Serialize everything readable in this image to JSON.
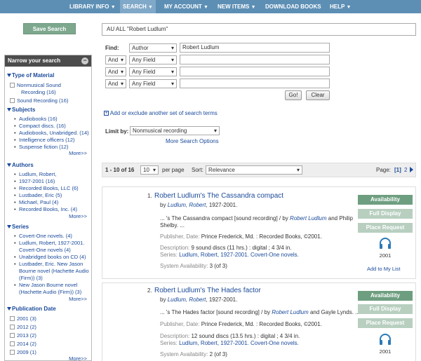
{
  "nav": {
    "items": [
      {
        "label": "LIBRARY INFO"
      },
      {
        "label": "SEARCH"
      },
      {
        "label": "MY ACCOUNT"
      },
      {
        "label": "NEW ITEMS"
      },
      {
        "label": "DOWNLOAD BOOKS"
      },
      {
        "label": "HELP"
      }
    ]
  },
  "sidebar": {
    "save_search": "Save Search",
    "narrow_title": "Narrow your search",
    "type_title": "Type of Material",
    "types": [
      "Nonmusical Sound",
      "Recording (16)",
      "Sound Recording (16)"
    ],
    "subjects_title": "Subjects",
    "subjects": [
      "Audiobooks (16)",
      "Compact discs. (16)",
      "Audiobooks, Unabridged. (14)",
      "Intelligence officers (12)",
      "Suspense fiction (12)"
    ],
    "more": "More>>",
    "authors_title": "Authors",
    "authors": [
      "Ludlum, Robert,",
      "1927-2001 (16)",
      "Recorded Books, LLC (6)",
      "Lustbader, Eric (5)",
      "Michael, Paul (4)",
      "Recorded Books, Inc. (4)"
    ],
    "series_title": "Series",
    "series": [
      "Covert-One novels. (4)",
      "Ludlum, Robert, 1927-2001.",
      "Covert-One novels (4)",
      "Unabridged books on CD (4)",
      "Lustbader, Eric. New Jason",
      "Bourne novel (Hachette Audio",
      "(Firm)) (3)",
      "New Jason Bourne novel",
      "(Hachette Audio (Firm)) (3)"
    ],
    "pubdate_title": "Publication Date",
    "pubdates": [
      "2001 (3)",
      "2012 (2)",
      "2013 (2)",
      "2014 (2)",
      "2009 (1)"
    ]
  },
  "search": {
    "query_summary": "AU ALL \"Robert Ludlum\"",
    "find_label": "Find:",
    "rows": [
      {
        "op": "",
        "field": "Author",
        "value": "Robert Ludlum"
      },
      {
        "op": "And",
        "field": "Any Field",
        "value": ""
      },
      {
        "op": "And",
        "field": "Any Field",
        "value": ""
      },
      {
        "op": "And",
        "field": "Any Field",
        "value": ""
      }
    ],
    "go": "Go!",
    "clear": "Clear",
    "add_set": "Add or exclude another set of search terms",
    "limit_label": "Limit by:",
    "limit_value": "Nonmusical recording",
    "more_options": "More Search Options"
  },
  "results": {
    "range": "1 - 10 of 16",
    "per_page_value": "10",
    "per_page_label": "per page",
    "sort_label": "Sort:",
    "sort_value": "Relevance",
    "page_label": "Page:",
    "current_page": "[1]",
    "next_page": "2"
  },
  "records": [
    {
      "num": "1.",
      "title": "Robert Ludlum's The Cassandra compact",
      "by": "by",
      "author": "Ludlum, Robert",
      "author_dates": ", 1927-2001.",
      "snippet_1": "... 's The Cassandra compact [sound recording] / by",
      "snippet_author": "Robert Ludlum",
      "snippet_2": "and Philip",
      "snippet_3": "Shelby. ...",
      "publisher_label": "Publisher, Date:",
      "publisher": "Prince Frederick, Md. : Recorded Books, ©2001.",
      "description_label": "Description:",
      "description": "9 sound discs (11 hrs.) : digital ; 4 3/4 in.",
      "series_label": "Series:",
      "series": "Ludlum, Robert, 1927-2001. Covert-One novels.",
      "availability_label": "System Availability:",
      "availability": "3 (of 3)",
      "year": "2001",
      "add_to_list": "Add to My List"
    },
    {
      "num": "2.",
      "title": "Robert Ludlum's The Hades factor",
      "by": "by",
      "author": "Ludlum, Robert",
      "author_dates": ", 1927-2001.",
      "snippet_1": "... 's The Hades factor [sound recording] / by",
      "snippet_author": "Robert Ludlum",
      "snippet_2": "and Gayle Lynds. ...",
      "publisher_label": "Publisher, Date:",
      "publisher": "Prince Frederick, Md. : Recorded Books, ©2001.",
      "description_label": "Description:",
      "description": "12 sound discs (13.5 hrs.) : digital ; 4 3/4 in.",
      "series_label": "Series:",
      "series": "Ludlum, Robert, 1927-2001. Covert-One novels.",
      "availability_label": "System Availability:",
      "availability": "2 (of 3)",
      "year": "2001"
    }
  ],
  "actions": {
    "availability": "Availability",
    "full_display": "Full Display",
    "place_request": "Place Request"
  }
}
